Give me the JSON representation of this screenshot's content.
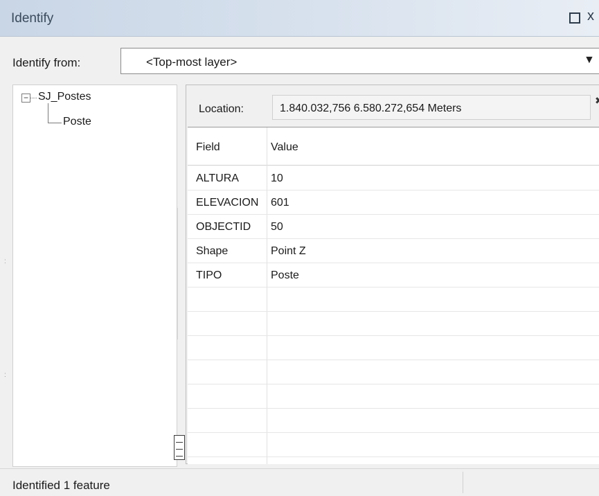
{
  "window": {
    "title": "Identify",
    "restore_icon": "restore-icon",
    "close_glyph": "x"
  },
  "identify_from": {
    "label": "Identify from:",
    "value": "<Top-most layer>"
  },
  "tree": {
    "layer": "SJ_Postes",
    "feature": "Poste",
    "expander_glyph": "−"
  },
  "location": {
    "label": "Location:",
    "value": "1.840.032,756  6.580.272,654 Meters"
  },
  "table": {
    "headers": {
      "field": "Field",
      "value": "Value"
    },
    "rows": [
      {
        "field": "ALTURA",
        "value": "10"
      },
      {
        "field": "ELEVACION",
        "value": "601"
      },
      {
        "field": "OBJECTID",
        "value": "50"
      },
      {
        "field": "Shape",
        "value": "Point Z"
      },
      {
        "field": "TIPO",
        "value": "Poste"
      }
    ]
  },
  "status": {
    "text": "Identified 1 feature"
  }
}
